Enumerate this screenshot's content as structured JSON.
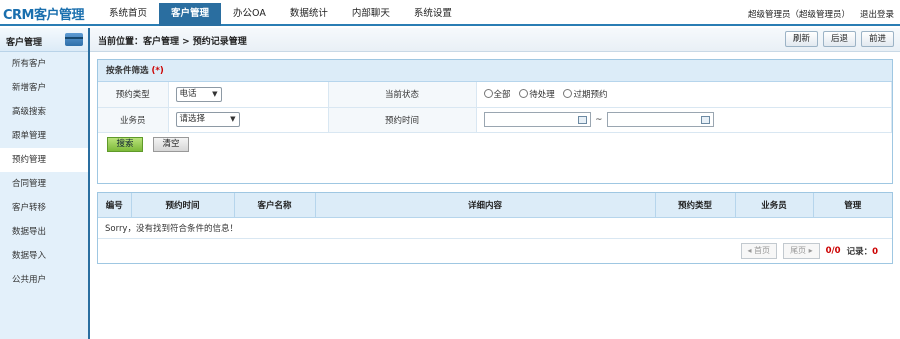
{
  "app": {
    "logo": "CRM客户管理"
  },
  "nav": [
    "系统首页",
    "客户管理",
    "办公OA",
    "数据统计",
    "内部聊天",
    "系统设置"
  ],
  "user": {
    "name": "超级管理员（超级管理员）",
    "logout": "退出登录"
  },
  "sidebar": {
    "title": "客户管理",
    "items": [
      "所有客户",
      "新增客户",
      "高级搜索",
      "跟单管理",
      "预约管理",
      "合同管理",
      "客户转移",
      "数据导出",
      "数据导入",
      "公共用户"
    ],
    "active_index": 4
  },
  "breadcrumb": "当前位置：客户管理 > 预约记录管理",
  "toolbar": {
    "refresh": "刷新",
    "back": "后退",
    "forward": "前进"
  },
  "filter": {
    "title": "按条件筛选",
    "required_mark": "(*)",
    "type_label": "预约类型",
    "type_value": "电话",
    "status_label": "当前状态",
    "status_options": [
      "全部",
      "待处理",
      "过期预约"
    ],
    "staff_label": "业务员",
    "staff_value": "请选择",
    "time_label": "预约时间",
    "time_sep": "~",
    "search_btn": "搜索",
    "clear_btn": "清空"
  },
  "results": {
    "columns": [
      "编号",
      "预约时间",
      "客户名称",
      "详细内容",
      "预约类型",
      "业务员",
      "管理"
    ],
    "empty_msg": "Sorry，没有找到符合条件的信息！"
  },
  "pager": {
    "first": "◂ 首页",
    "last": "尾页 ▸",
    "page_value": "0/0",
    "records_label": "记录：",
    "records_value": "0"
  },
  "colors": {
    "brand": "#1a6fae",
    "nav_active": "#2a6ea0",
    "header_bg": "#dcecf8",
    "search_btn": "#7db93a"
  }
}
